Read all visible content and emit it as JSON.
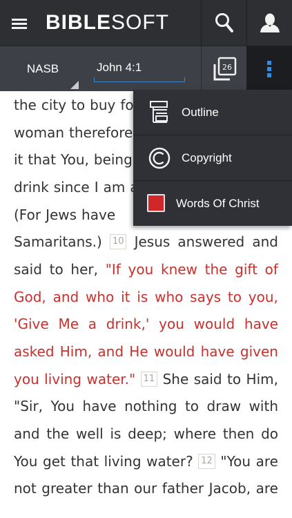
{
  "header": {
    "brand_bold": "BIBLE",
    "brand_light": "SOFT"
  },
  "toolbar": {
    "version": "NASB",
    "reference": "John 4:1",
    "tab_count": "26"
  },
  "menu": {
    "items": [
      {
        "label": "Outline",
        "icon": "outline-icon"
      },
      {
        "label": "Copyright",
        "icon": "copyright-icon"
      },
      {
        "label": "Words Of Christ",
        "icon": "red-square-toggle"
      }
    ]
  },
  "text": {
    "lines": [
      [
        "the",
        "city",
        "to",
        "buy",
        "fo"
      ],
      [
        "woman",
        "therefore"
      ],
      [
        "it",
        "that",
        "You,",
        "being"
      ],
      [
        "drink",
        "since",
        "I",
        "am",
        "a"
      ],
      [
        "(For",
        "Jews",
        "have"
      ],
      [
        "Samaritans.)"
      ],
      [
        "said",
        "to",
        "her,"
      ],
      [
        "God,",
        "and",
        "who",
        "it",
        "is",
        "who",
        "says",
        "to",
        "you,"
      ],
      [
        "'Give",
        "Me",
        "a",
        "drink,'",
        "you",
        "would",
        "have"
      ],
      [
        "asked",
        "Him,",
        "and",
        "He",
        "would",
        "have",
        "given"
      ],
      [
        "you",
        "living",
        "water.\""
      ],
      [
        "\"Sir,",
        "You",
        "have",
        "nothing",
        "to",
        "draw",
        "with"
      ],
      [
        "and",
        "the",
        "well",
        "is",
        "deep;",
        "where",
        "then",
        "do"
      ],
      [
        "You",
        "get",
        "that",
        "living",
        "water?"
      ],
      [
        "not",
        "greater",
        "than",
        "our",
        "father",
        "Jacob,",
        "are"
      ]
    ],
    "verse_10": "10",
    "verse_10_after": [
      "Jesus",
      "answered",
      "and"
    ],
    "line7_red": [
      "\"If",
      "you",
      "knew",
      "the",
      "gift",
      "of"
    ],
    "verse_11": "11",
    "verse_11_after": [
      "She",
      "said",
      "to",
      "Him,"
    ],
    "verse_12": "12",
    "verse_12_after": [
      "\"You",
      "are"
    ]
  },
  "colors": {
    "words_of_christ": "#c9302c",
    "accent": "#2f8de4"
  }
}
